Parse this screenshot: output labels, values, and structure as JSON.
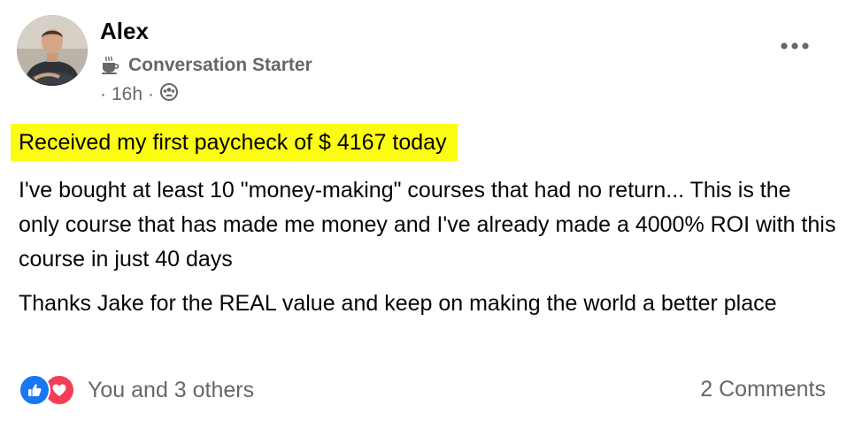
{
  "post": {
    "author": "Alex",
    "badge": {
      "icon": "coffee-cup-icon",
      "label": "Conversation Starter"
    },
    "timestamp": "16h",
    "audience_icon": "group-icon",
    "highlight_text": "Received my first paycheck of $ 4167 today",
    "highlight_color": "#fcfc12",
    "paragraphs": [
      "I've bought at least 10 \"money-making\" courses that had no return... This is the only course that has made me money and I've already made a 4000% ROI with this course in just 40 days",
      "Thanks Jake for the REAL value and keep on making the world a better place"
    ],
    "reactions": {
      "icons": [
        "like-icon",
        "love-icon"
      ],
      "text": "You and 3 others"
    },
    "comments": "2 Comments"
  },
  "colors": {
    "like": "#1877f2",
    "love": "#f33e58",
    "secondary_text": "#65676b"
  }
}
